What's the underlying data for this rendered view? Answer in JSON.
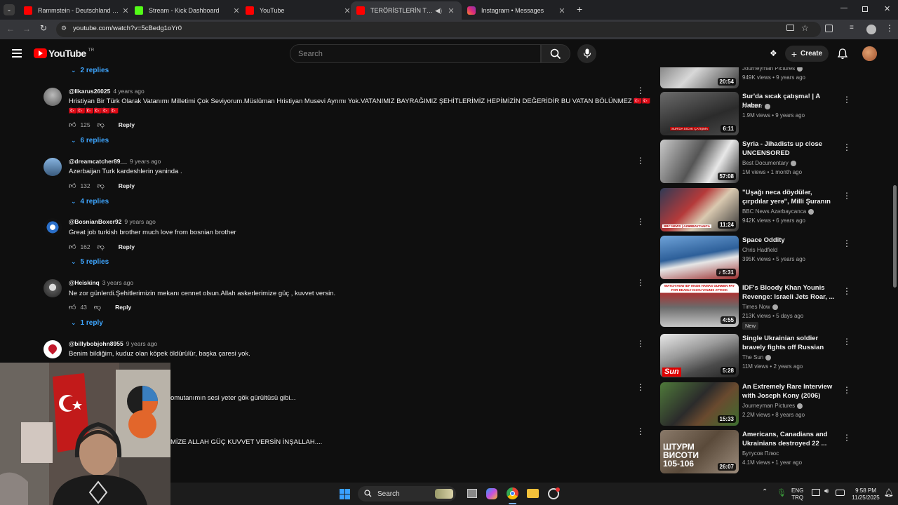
{
  "browser": {
    "tabs": [
      {
        "label": "Rammstein - Deutschland (Offi",
        "favicon": "youtube-icon",
        "active": false
      },
      {
        "label": "Stream - Kick Dashboard",
        "favicon": "kick-icon",
        "active": false
      },
      {
        "label": "YouTube",
        "favicon": "youtube-icon",
        "active": false
      },
      {
        "label": "TERÖRİSTLERİN TESLİM OL",
        "favicon": "youtube-icon",
        "active": true
      },
      {
        "label": "Instagram • Messages",
        "favicon": "instagram-icon",
        "active": false
      }
    ],
    "url": "youtube.com/watch?v=5cBedg1oYr0",
    "colors": {
      "tabstrip": "#202124",
      "active_tab": "#35363a"
    }
  },
  "youtube": {
    "logo_text": "YouTube",
    "region": "TR",
    "search_placeholder": "Search",
    "create_label": "Create"
  },
  "comments": {
    "top_replies": "2 replies",
    "items": [
      {
        "handle": "@Ilkarus26025",
        "ago": "4 years ago",
        "text": "Hristiyan Bir Türk Olarak Vatanımı Milletimi Çok Seviyorum.Müslüman Hristiyan Musevi Ayrımı Yok.VATANIMIZ BAYRAĞIMIZ ŞEHİTLERİMİZ HEPİMİZİN DEĞERİDİR BU VATAN BÖLÜNMEZ 🇹🇷🇹🇷🇹🇷🇹🇷🇹🇷🇹🇷🇹🇷🇹🇷",
        "likes": "125",
        "reply_label": "Reply",
        "replies": "6 replies"
      },
      {
        "handle": "@dreamcatcher89__",
        "ago": "9 years ago",
        "text": "Azerbaijan Turk kardeshlerin yaninda .",
        "likes": "132",
        "reply_label": "Reply",
        "replies": "4 replies"
      },
      {
        "handle": "@BosnianBoxer92",
        "ago": "9 years ago",
        "text": "Great job turkish brother much love from bosnian brother",
        "likes": "162",
        "reply_label": "Reply",
        "replies": "5 replies"
      },
      {
        "handle": "@Heiskinq",
        "ago": "3 years ago",
        "text": "Ne zor günlerdi.Şehitlerimizin mekanı cennet olsun.Allah askerlerimize güç , kuvvet versin.",
        "likes": "43",
        "reply_label": "Reply",
        "replies": "1 reply"
      },
      {
        "handle": "@billybobjohn8955",
        "ago": "9 years ago",
        "text": "Benim bildiğim, kuduz olan köpek öldürülür, başka çaresi yok."
      }
    ],
    "partial_1": "omutanımın sesi yeter gök gürültüsü gibi...",
    "partial_2": "MİZE ALLAH GÜÇ KUVVET VERSİN İNŞALLAH...."
  },
  "sidebar": {
    "videos": [
      {
        "title": "",
        "channel": "Journeyman Pictures",
        "stats": "949K views • 9 years ago",
        "duration": "20:54",
        "verified": true
      },
      {
        "title": "Sur'da sıcak çatışma! | A Haber",
        "channel": "A Haber",
        "stats": "1.9M views • 9 years ago",
        "duration": "6:11",
        "verified": true,
        "thumb_caption": "SUR'DA SICAK ÇATIŞMA"
      },
      {
        "title": "Syria - Jihadists up close UNCENSORED",
        "channel": "Best Documentary",
        "stats": "1M views • 1 month ago",
        "duration": "57:08",
        "verified": true
      },
      {
        "title": "\"Uşağı neca döydülər, çırpdılar yerə\", Milli Şuranın mitinqində...",
        "channel": "BBC News Azərbaycanca",
        "stats": "942K views • 6 years ago",
        "duration": "11:24",
        "verified": true,
        "thumb_caption": "BBC NEWS | AZƏRBAYCANCA"
      },
      {
        "title": "Space Oddity",
        "channel": "Chris Hadfield",
        "stats": "395K views • 5 years ago",
        "duration": "5:31",
        "verified": false
      },
      {
        "title": "IDF's Bloody Khan Younis Revenge: Israeli Jets Roar, ...",
        "channel": "Times Now",
        "stats": "213K views • 5 days ago",
        "duration": "4:55",
        "verified": true,
        "badge": "New",
        "thumb_caption": "WATCH HOW IDF MADE HAMAS GUNMEN PAY FOR DEADLY KHAN YOUNIS ATTACK"
      },
      {
        "title": "Single Ukrainian soldier bravely fights off Russian attack on ...",
        "channel": "The Sun",
        "stats": "11M views • 2 years ago",
        "duration": "5:28",
        "verified": true,
        "thumb_caption": "Sun"
      },
      {
        "title": "An Extremely Rare Interview with Joseph Kony (2006)",
        "channel": "Journeyman Pictures",
        "stats": "2.2M views • 8 years ago",
        "duration": "15:33",
        "verified": true
      },
      {
        "title": "Americans, Canadians and Ukrainians destroyed 22 ...",
        "channel": "Бутусов Плюс",
        "stats": "4.1M views • 1 year ago",
        "duration": "26:07",
        "verified": false,
        "thumb_caption": "ШТУРМ ВИСОТИ 105-106"
      }
    ]
  },
  "taskbar": {
    "search_label": "Search",
    "lang_top": "ENG",
    "lang_bottom": "TRQ",
    "time": "9:58 PM",
    "date": "11/25/2025"
  }
}
